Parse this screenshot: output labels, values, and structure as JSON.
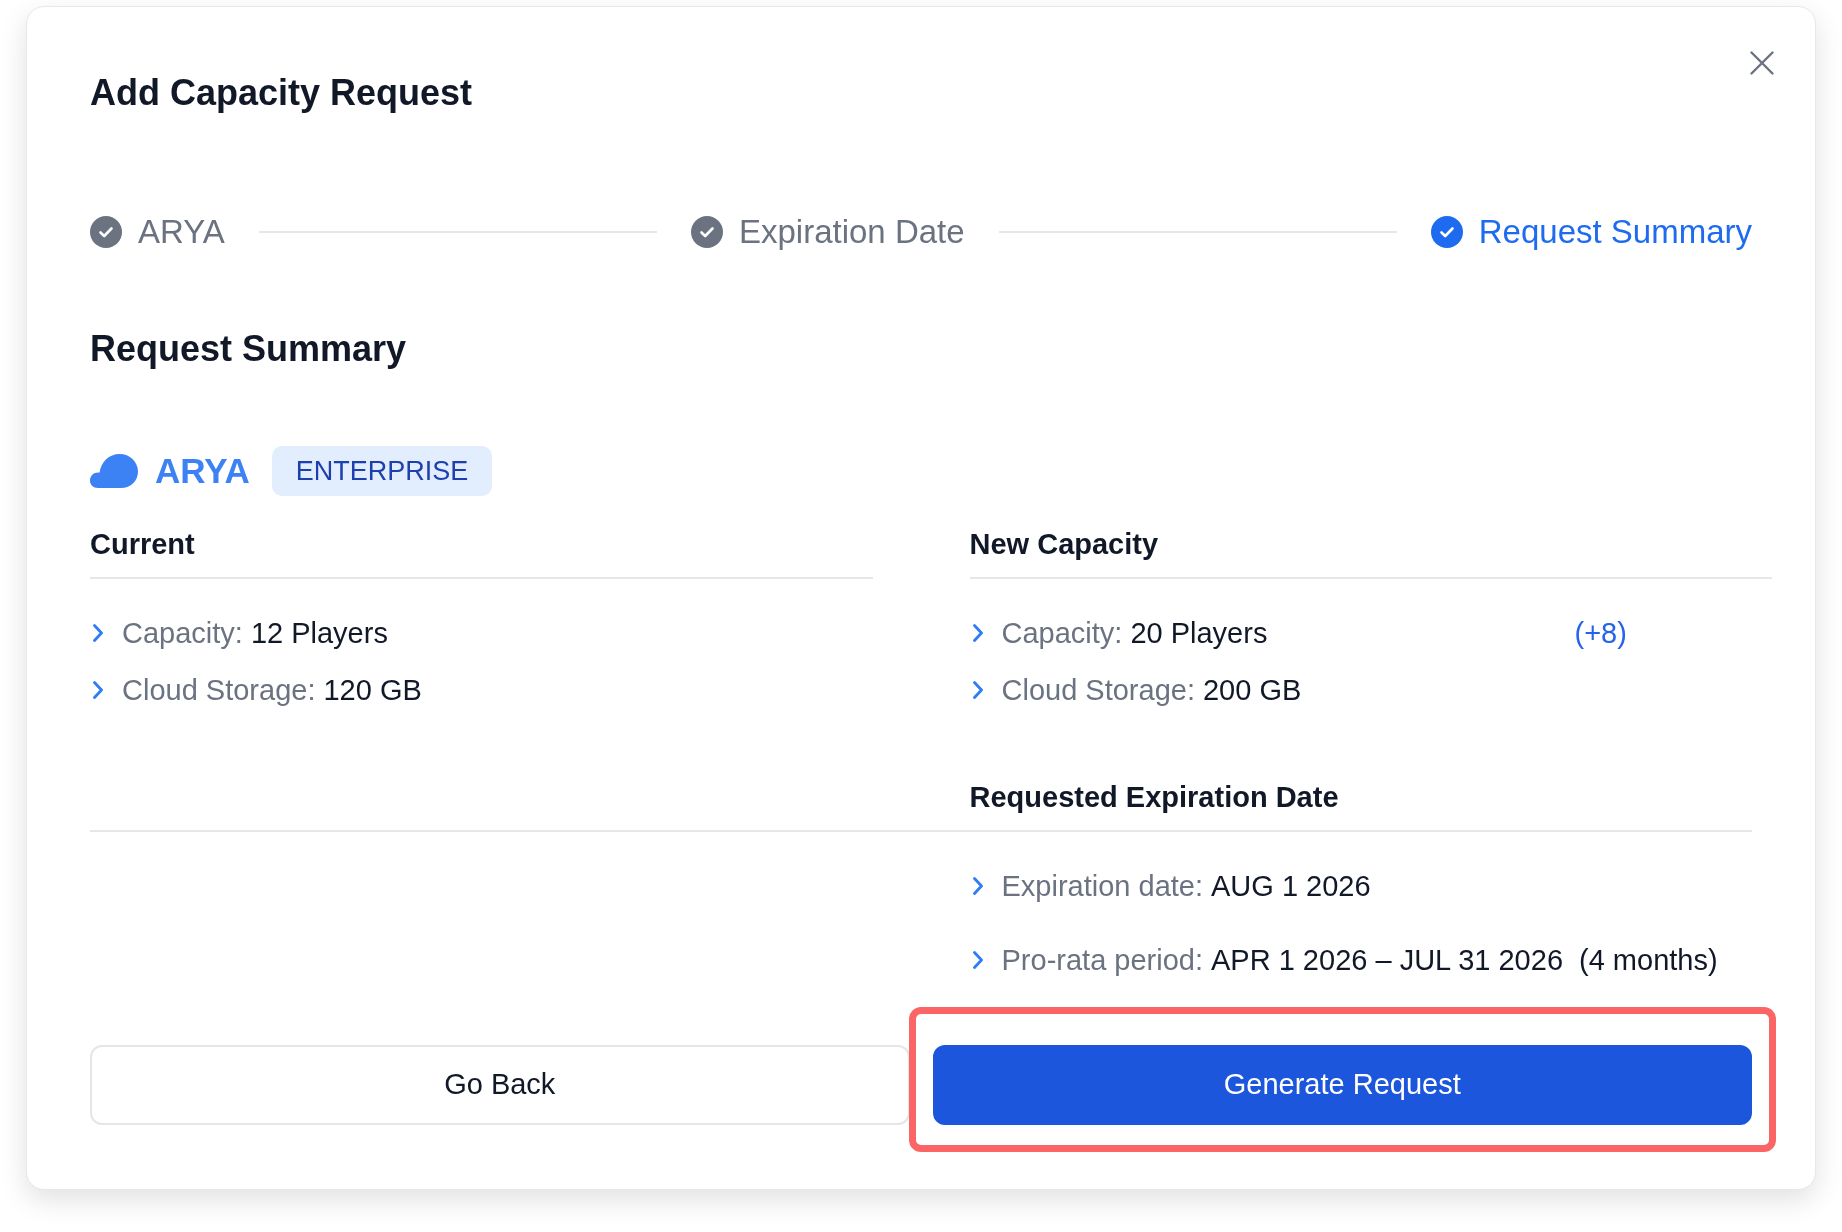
{
  "dialog": {
    "title": "Add Capacity Request"
  },
  "steps": [
    {
      "label": "ARYA",
      "selected": false
    },
    {
      "label": "Expiration Date",
      "selected": false
    },
    {
      "label": "Request Summary",
      "selected": true
    }
  ],
  "summary": {
    "heading": "Request Summary",
    "product": {
      "name": "ARYA",
      "badge": "ENTERPRISE"
    },
    "current": {
      "heading": "Current",
      "items": [
        {
          "label": "Capacity:",
          "value": "12 Players"
        },
        {
          "label": "Cloud Storage:",
          "value": "120 GB"
        }
      ]
    },
    "new_capacity": {
      "heading": "New Capacity",
      "items": [
        {
          "label": "Capacity:",
          "value": "20 Players",
          "delta": "(+8)"
        },
        {
          "label": "Cloud Storage:",
          "value": "200 GB"
        }
      ]
    },
    "expiration": {
      "heading": "Requested Expiration Date",
      "items": [
        {
          "label": "Expiration date:",
          "value": "AUG 1 2026"
        },
        {
          "label": "Pro-rata period:",
          "value": "APR 1 2026 – JUL 31 2026",
          "note": "(4 months)"
        }
      ]
    }
  },
  "buttons": [
    {
      "label": "Go Back",
      "kind": "secondary",
      "highlighted": false
    },
    {
      "label": "Generate Request",
      "kind": "primary",
      "highlighted": true
    }
  ]
}
